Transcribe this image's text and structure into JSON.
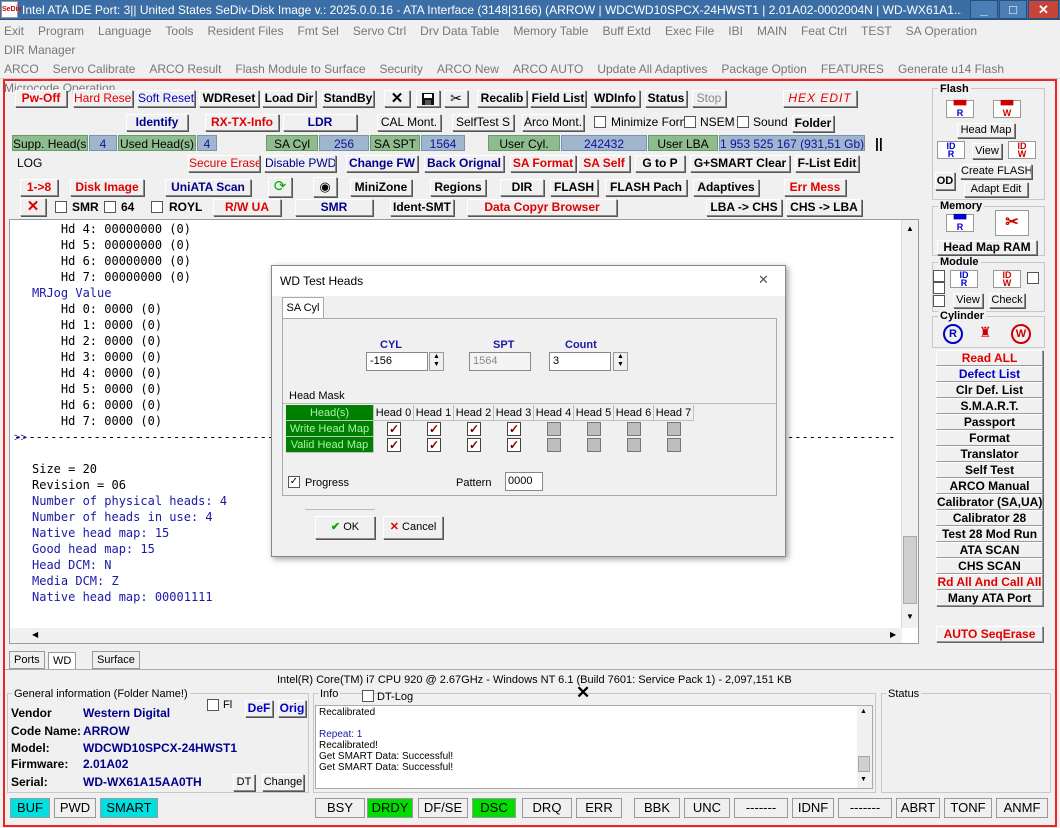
{
  "window": {
    "app_icon": "SeDiv",
    "title": "Intel ATA IDE  Port: 3|| United States  SeDiv-Disk Image v.: 2025.0.0.16 - ATA Interface (3148|3166)  (ARROW | WDCWD10SPCX-24HWST1 | 2.01A02-0002004N | WD-WX61A1..."
  },
  "menu": {
    "row1": [
      "Exit",
      "Program",
      "Language",
      "Tools",
      "Resident Files",
      "Fmt Sel",
      "Servo Ctrl",
      "Drv Data Table",
      "Memory Table",
      "Buff Extd",
      "Exec File",
      "IBI",
      "MAIN",
      "Feat Ctrl",
      "TEST",
      "SA Operation",
      "DIR Manager"
    ],
    "row2": [
      "ARCO",
      "Servo Calibrate",
      "ARCO Result",
      "Flash Module to Surface",
      "Security",
      "ARCO New",
      "ARCO AUTO",
      "Update All Adaptives",
      "Package Option",
      "FEATURES",
      "Generate u14 Flash"
    ],
    "row3": [
      "Microcode Operation"
    ]
  },
  "toolbar": {
    "pw_off": "Pw-Off",
    "hard_reset": "Hard Reset",
    "soft_reset": "Soft Reset",
    "wdreset": "WDReset",
    "load_dir": "Load Dir",
    "standby": "StandBy",
    "recalib": "Recalib",
    "field_list": "Field List",
    "wdinfo": "WDInfo",
    "status": "Status",
    "stop": "Stop",
    "hex_edit": "HEX EDIT",
    "identify": "Identify",
    "rx_tx_info": "RX-TX-Info",
    "ldr": "LDR",
    "cal_mont": "CAL Mont.",
    "selftest_s": "SelfTest S",
    "arco_mont": "Arco Mont.",
    "minimize_form": "Minimize Form",
    "nsem": "NSEM",
    "sound": "Sound",
    "folder": "Folder",
    "secure_erase": "Secure Erase",
    "disable_pwd": "Disable PWD",
    "change_fw": "Change FW",
    "back_orignal": "Back Orignal",
    "sa_format": "SA Format",
    "sa_self": "SA Self",
    "g_to_p": "G to P",
    "g_smart_clear": "G+SMART Clear",
    "f_list_edit": "F-List Edit",
    "one_to_eight": "1->8",
    "disk_image": "Disk Image",
    "uniata_scan": "UniATA Scan",
    "minizone": "MiniZone",
    "regions": "Regions",
    "dir": "DIR",
    "flash": "FLASH",
    "flash_pach": "FLASH Pach",
    "adaptives": "Adaptives",
    "err_mess": "Err Mess",
    "smr": "SMR",
    "sixty_four": "64",
    "royl": "ROYL",
    "rw_ua": "R/W UA",
    "smr_btn": "SMR",
    "ident_smt": "Ident-SMT",
    "data_copyr_browser": "Data Copyr Browser",
    "lba_chs": "LBA -> CHS",
    "chs_lba": "CHS -> LBA"
  },
  "status_fields": {
    "supp_heads_lbl": "Supp. Head(s)",
    "supp_heads_val": "4",
    "used_heads_lbl": "Used Head(s)",
    "used_heads_val": "4",
    "sa_cyl_lbl": "SA Cyl",
    "sa_cyl_val": "256",
    "sa_spt_lbl": "SA SPT",
    "sa_spt_val": "1564",
    "user_cyl_lbl": "User Cyl.",
    "user_cyl_val": "242432",
    "user_lba_lbl": "User LBA",
    "user_lba_val": "1 953 525 167  (931,51 Gb)",
    "log_label": "LOG"
  },
  "log": {
    "lines": [
      {
        "t": "    Hd 4: 00000000 (0)",
        "c": "#000"
      },
      {
        "t": "    Hd 5: 00000000 (0)",
        "c": "#000"
      },
      {
        "t": "    Hd 6: 00000000 (0)",
        "c": "#000"
      },
      {
        "t": "    Hd 7: 00000000 (0)",
        "c": "#000"
      },
      {
        "t": "MRJog Value",
        "c": "#1a1aa6"
      },
      {
        "t": "    Hd 0: 0000 (0)",
        "c": "#000"
      },
      {
        "t": "    Hd 1: 0000 (0)",
        "c": "#000"
      },
      {
        "t": "    Hd 2: 0000 (0)",
        "c": "#000"
      },
      {
        "t": "    Hd 3: 0000 (0)",
        "c": "#000"
      },
      {
        "t": "    Hd 4: 0000 (0)",
        "c": "#000"
      },
      {
        "t": "    Hd 5: 0000 (0)",
        "c": "#000"
      },
      {
        "t": "    Hd 6: 0000 (0)",
        "c": "#000"
      },
      {
        "t": "    Hd 7: 0000 (0)",
        "c": "#000"
      },
      {
        "t": "--------------------------------------------------------------------------------------------------------------------------",
        "c": "#000"
      },
      {
        "t": "",
        "c": "#000"
      },
      {
        "t": "Size = 20",
        "c": "#000"
      },
      {
        "t": "Revision = 06",
        "c": "#000"
      },
      {
        "t": "Number of physical heads: 4",
        "c": "#1a1aa6"
      },
      {
        "t": "Number of heads in use: 4",
        "c": "#1a1aa6"
      },
      {
        "t": "Native head map: 15",
        "c": "#1a1aa6"
      },
      {
        "t": "Good head map: 15",
        "c": "#1a1aa6"
      },
      {
        "t": "Head DCM: N",
        "c": "#1a1aa6"
      },
      {
        "t": "Media DCM: Z",
        "c": "#1a1aa6"
      },
      {
        "t": "Native head map: 00001111",
        "c": "#1a1aa6"
      }
    ],
    "gutter_marker": ">>"
  },
  "dialog": {
    "title": "WD Test Heads",
    "tab": "SA Cyl",
    "cyl_label": "CYL",
    "cyl_value": "-156",
    "spt_label": "SPT",
    "spt_value": "1564",
    "count_label": "Count",
    "count_value": "3",
    "head_mask_label": "Head Mask",
    "row_header": "Head(s)",
    "write_label": "Write Head Map",
    "valid_label": "Valid Head Map",
    "heads": [
      "Head 0",
      "Head 1",
      "Head 2",
      "Head 3",
      "Head 4",
      "Head 5",
      "Head 6",
      "Head 7"
    ],
    "write_checked": [
      true,
      true,
      true,
      true,
      false,
      false,
      false,
      false
    ],
    "valid_checked": [
      true,
      true,
      true,
      true,
      false,
      false,
      false,
      false
    ],
    "enabled_count": 4,
    "progress_label": "Progress",
    "pattern_label": "Pattern",
    "pattern_value": "0000",
    "ok": "OK",
    "cancel": "Cancel"
  },
  "right_panel": {
    "flash_title": "Flash",
    "head_map": "Head Map",
    "view": "View",
    "od": "OD",
    "create_flash": "Create FLASH",
    "adapt_edit": "Adapt Edit",
    "memory_title": "Memory",
    "head_map_ram": "Head Map RAM",
    "module_title": "Module",
    "view2": "View",
    "check": "Check",
    "cylinder_title": "Cylinder",
    "buttons": [
      {
        "label": "Read ALL",
        "color": "#e00000"
      },
      {
        "label": "Defect List",
        "color": "#0000c8"
      },
      {
        "label": "Clr Def. List",
        "color": "#000"
      },
      {
        "label": "S.M.A.R.T.",
        "color": "#000"
      },
      {
        "label": "Passport",
        "color": "#000"
      },
      {
        "label": "Format",
        "color": "#000"
      },
      {
        "label": "Translator",
        "color": "#000"
      },
      {
        "label": "Self Test",
        "color": "#000"
      },
      {
        "label": "ARCO Manual",
        "color": "#000"
      },
      {
        "label": "Calibrator (SA,UA)",
        "color": "#000"
      },
      {
        "label": "Calibrator 28",
        "color": "#000"
      },
      {
        "label": "Test 28 Mod Run",
        "color": "#000"
      },
      {
        "label": "ATA SCAN",
        "color": "#000"
      },
      {
        "label": "CHS SCAN",
        "color": "#000"
      },
      {
        "label": "Rd All And Call All",
        "color": "#e00000"
      },
      {
        "label": "Many ATA Port",
        "color": "#000"
      }
    ],
    "auto_seqerase": "AUTO SeqErase"
  },
  "bottom_tabs": [
    "Ports",
    "WD",
    "Surface"
  ],
  "cpu_line": "Intel(R) Core(TM) i7 CPU 920  @ 2.67GHz - Windows NT 6.1 (Build 7601: Service Pack 1) - 2,097,151 KB",
  "general_info": {
    "title": "General information (Folder Name!)",
    "fl": "Fl",
    "def": "DeF",
    "orig": "Orig",
    "vendor_lbl": "Vendor",
    "vendor": "Western Digital",
    "code_lbl": "Code Name:",
    "code": "ARROW",
    "model_lbl": "Model:",
    "model": "WDCWD10SPCX-24HWST1",
    "fw_lbl": "Firmware:",
    "fw": "2.01A02",
    "serial_lbl": "Serial:",
    "serial": "WD-WX61A15AA0TH",
    "dt": "DT",
    "change": "Change"
  },
  "info_panel": {
    "title": "Info",
    "dtlog": "DT-Log",
    "lines": [
      {
        "t": "Recalibrated",
        "c": "#000"
      },
      {
        "t": "",
        "c": "#000"
      },
      {
        "t": "Repeat: 1",
        "c": "#1a1aa6"
      },
      {
        "t": "Recalibrated!",
        "c": "#000"
      },
      {
        "t": "Get SMART Data: Successful!",
        "c": "#000"
      },
      {
        "t": "Get SMART Data: Successful!",
        "c": "#000"
      }
    ]
  },
  "status_panel": {
    "title": "Status"
  },
  "status_bar": [
    {
      "label": "BUF",
      "bg": "#00e0e0"
    },
    {
      "label": "PWD",
      "bg": "#f0f0f0"
    },
    {
      "label": "SMART",
      "bg": "#00e0e0"
    },
    {
      "label": "BSY",
      "bg": "#f0f0f0"
    },
    {
      "label": "DRDY",
      "bg": "#00dd00"
    },
    {
      "label": "DF/SE",
      "bg": "#f0f0f0"
    },
    {
      "label": "DSC",
      "bg": "#00dd00"
    },
    {
      "label": "DRQ",
      "bg": "#f0f0f0"
    },
    {
      "label": "ERR",
      "bg": "#f0f0f0"
    },
    {
      "label": "BBK",
      "bg": "#f0f0f0"
    },
    {
      "label": "UNC",
      "bg": "#f0f0f0"
    },
    {
      "label": "-------",
      "bg": "#f0f0f0"
    },
    {
      "label": "IDNF",
      "bg": "#f0f0f0"
    },
    {
      "label": "-------",
      "bg": "#f0f0f0"
    },
    {
      "label": "ABRT",
      "bg": "#f0f0f0"
    },
    {
      "label": "TONF",
      "bg": "#f0f0f0"
    },
    {
      "label": "ANMF",
      "bg": "#f0f0f0"
    }
  ],
  "colors": {
    "accent_red": "#e00000",
    "link_blue": "#0000c8",
    "titlebar": "#3a6ea5"
  }
}
